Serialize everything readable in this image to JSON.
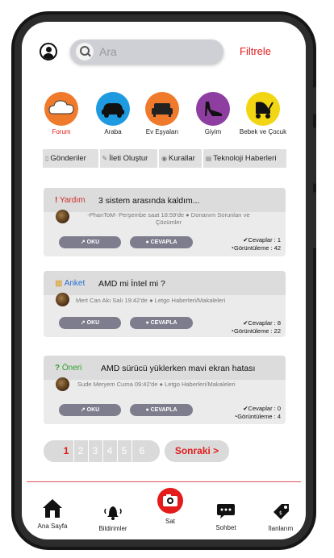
{
  "search": {
    "placeholder": "Ara"
  },
  "filter_label": "Filtrele",
  "categories": [
    {
      "label": "Forum",
      "color": "#f07a2c"
    },
    {
      "label": "Araba",
      "color": "#1e9be0"
    },
    {
      "label": "Ev Eşyaları",
      "color": "#f07a2c"
    },
    {
      "label": "Giyim",
      "color": "#8e3ea0"
    },
    {
      "label": "Bebek ve Çocuk",
      "color": "#f2d613"
    }
  ],
  "toolbar": [
    {
      "label": "Gönderiler"
    },
    {
      "label": "İleti Oluştur"
    },
    {
      "label": "Kurallar"
    },
    {
      "label": "Teknoloji Haberleri"
    }
  ],
  "posts": [
    {
      "tag": "Yardım",
      "tag_color": "#d02a2a",
      "tag_icon": "!",
      "title": "3 sistem arasında kaldım...",
      "meta_line1": "-PhanToM- Perşembe saat 18:59'de  ● Donanım Sorunları ve",
      "meta_line2": "Çözümler",
      "read_label": "OKU",
      "reply_label": "CEVAPLA",
      "replies_label": "✔Cevaplar :  1",
      "views_label": "◔Görüntüleme : 42"
    },
    {
      "tag": "Anket",
      "tag_color": "#2a6fd0",
      "tag_icon": "▦",
      "title": "AMD mi İntel mi ?",
      "meta_line1": "Mert Can Akı Salı 19:42'de ● Letgo Haberleri/Makaleleri",
      "meta_line2": "",
      "read_label": "OKU",
      "reply_label": "CEVAPLA",
      "replies_label": "✔Cevaplar :  8",
      "views_label": "◔Görüntüleme : 22"
    },
    {
      "tag": "Öneri",
      "tag_color": "#2fa02f",
      "tag_icon": "?",
      "title": "AMD sürücü yüklerken mavi ekran hatası",
      "meta_line1": "Sude Meryem Cuma 09:42'de ● Letgo Haberleri/Makaleleri",
      "meta_line2": "",
      "read_label": "OKU",
      "reply_label": "CEVAPLA",
      "replies_label": "✔Cevaplar :  0",
      "views_label": "◔Görüntüleme : 4"
    }
  ],
  "pagination": {
    "pages": [
      "1",
      "2",
      "3",
      "4",
      "5",
      "6"
    ],
    "current": "1",
    "next_label": "Sonraki >"
  },
  "bottom_nav": [
    {
      "label": "Ana Sayfa"
    },
    {
      "label": "Bildirimler"
    },
    {
      "label": "Sat"
    },
    {
      "label": "Sohbet"
    },
    {
      "label": "İlanlarım"
    }
  ]
}
